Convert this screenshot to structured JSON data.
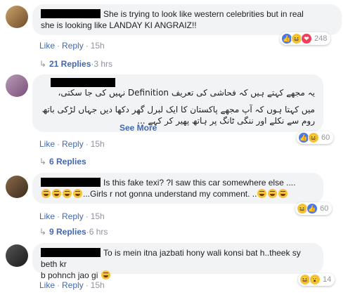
{
  "actions": {
    "like": "Like",
    "reply": "Reply",
    "dot": "·"
  },
  "comments": [
    {
      "text1": "She is trying to look like western celebrities but in real",
      "text2": "she is looking like LANDAY KI ANGRAIZ!!",
      "time": "15h",
      "reaction_count": "248",
      "replies_label": "21 Replies",
      "replies_time": "3 hrs"
    },
    {
      "urdu1": "یہ مجھے کہتے ہیں کہ فحاشی کی تعریف Definition نہیں کی جا سکتی،",
      "urdu2": "میں کہتا ہوں کہ آپ مجھے پاکستان کا ایک لبرل گھر دکھا دیں جہاں لڑکی باتھ",
      "urdu3": "روم سے نکلے اور ننگی ٹانگ پر ہاتھ پھیر کر کہے ...",
      "see_more": "See More",
      "time": "15h",
      "reaction_count": "60",
      "replies_label": "6 Replies"
    },
    {
      "text1": "Is this fake texi? ?I saw this car somewhere else ....",
      "text2": "...Girls r not gonna understand my comment. ..",
      "time": "15h",
      "reaction_count": "60",
      "replies_label": "9 Replies",
      "replies_time": "6 hrs"
    },
    {
      "text1": "To is mein itna jazbati hony wali konsi bat h..theek sy beth kr",
      "text2": "b pohnch jao gi",
      "time": "15h",
      "reaction_count": "14"
    }
  ],
  "colors": {
    "link": "#4267b2",
    "bubble": "#f2f3f5",
    "meta": "#90949c"
  }
}
